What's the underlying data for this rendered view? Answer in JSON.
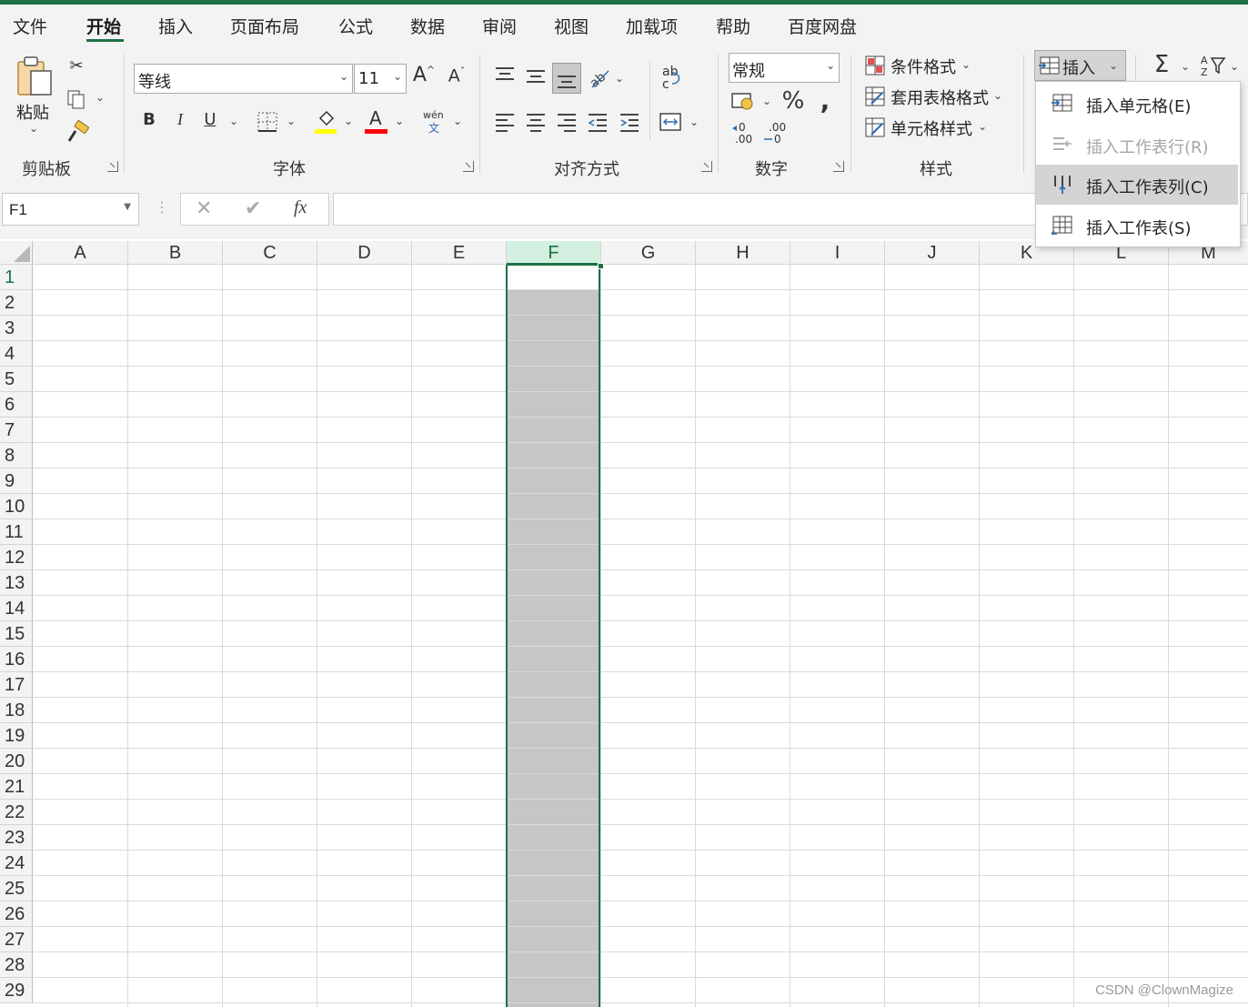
{
  "tabs": [
    "文件",
    "开始",
    "插入",
    "页面布局",
    "公式",
    "数据",
    "审阅",
    "视图",
    "加载项",
    "帮助",
    "百度网盘"
  ],
  "groups": {
    "clipboard": "剪贴板",
    "font": "字体",
    "alignment": "对齐方式",
    "number": "数字",
    "styles": "样式"
  },
  "clipboard": {
    "paste_label": "粘贴"
  },
  "font": {
    "name": "等线",
    "size": "11",
    "phonetic_top": "wén",
    "phonetic_bottom": "文"
  },
  "number": {
    "format": "常规"
  },
  "styles": {
    "conditional": "条件格式",
    "table": "套用表格格式",
    "cell": "单元格样式"
  },
  "cells": {
    "insert_label": "插入"
  },
  "insert_menu": {
    "items": [
      {
        "label": "插入单元格(E)"
      },
      {
        "label": "插入工作表行(R)"
      },
      {
        "label": "插入工作表列(C)"
      },
      {
        "label": "插入工作表(S)"
      }
    ]
  },
  "formula_bar": {
    "name_box": "F1",
    "fx": "fx",
    "value": ""
  },
  "sheet": {
    "columns": [
      "A",
      "B",
      "C",
      "D",
      "E",
      "F",
      "G",
      "H",
      "I",
      "J",
      "K",
      "L",
      "M"
    ],
    "rows": [
      "1",
      "2",
      "3",
      "4",
      "5",
      "6",
      "7",
      "8",
      "9",
      "10",
      "11",
      "12",
      "13",
      "14",
      "15",
      "16",
      "17",
      "18",
      "19",
      "20",
      "21",
      "22",
      "23",
      "24",
      "25",
      "26",
      "27",
      "28",
      "29"
    ],
    "selected_column": "F",
    "active_cell": "F1"
  },
  "colors": {
    "accent": "#1e7145",
    "selection_fill": "#c6c6c6",
    "header_selected": "#d3f0e0"
  },
  "watermark": "CSDN @ClownMagize"
}
